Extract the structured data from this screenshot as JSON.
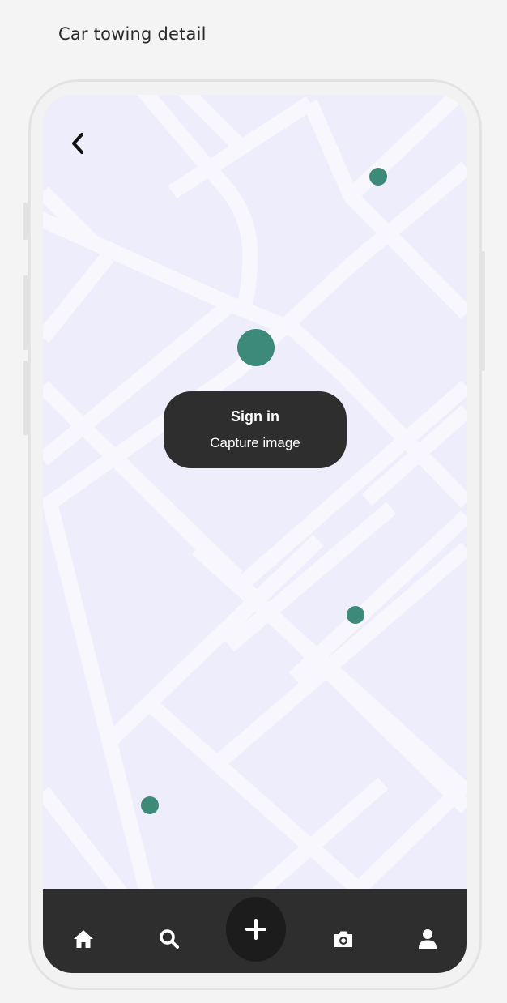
{
  "page": {
    "title": "Car towing detail"
  },
  "popup": {
    "title": "Sign in",
    "subtitle": "Capture image"
  },
  "icons": {
    "back": "chevron-left-icon",
    "home": "home-icon",
    "search": "search-icon",
    "add": "plus-icon",
    "camera": "camera-icon",
    "profile": "user-icon"
  },
  "colors": {
    "map_background": "#eeedfb",
    "road": "#f8f7fd",
    "marker": "#3d8a78",
    "tab_bar": "#2e2e2e",
    "fab": "#1c1c1c",
    "popup": "#2e2e2e"
  }
}
